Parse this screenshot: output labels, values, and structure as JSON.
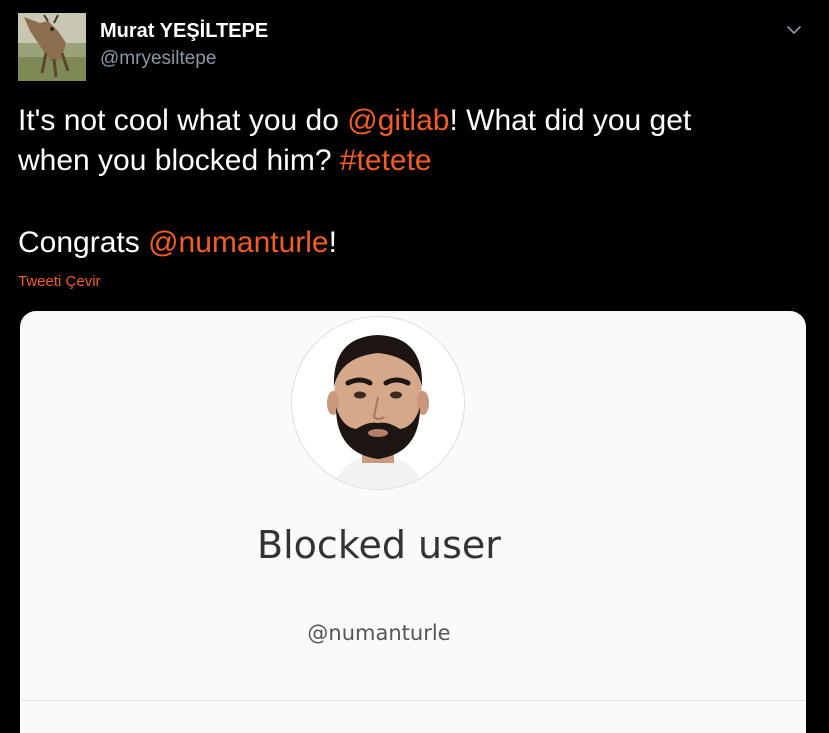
{
  "colors": {
    "background": "#000000",
    "accent": "#f45d22",
    "secondary_text": "#8899a6",
    "card_background": "#fafafa"
  },
  "author": {
    "name": "Murat YEŞİLTEPE",
    "handle": "@mryesiltepe",
    "avatar_icon": "goat-avatar"
  },
  "tweet": {
    "line1_prefix": "It's not cool what you do ",
    "line1_mention": "@gitlab",
    "line1_suffix": "! What did you get",
    "line2_prefix": "when you blocked him? ",
    "line2_hashtag": "#tetete",
    "line3_prefix": "Congrats ",
    "line3_mention": "@numanturle",
    "line3_suffix": "!",
    "translate_link": "Tweeti Çevir"
  },
  "card": {
    "title": "Blocked user",
    "handle": "@numanturle",
    "photo_icon": "bearded-man-profile-photo"
  },
  "menu_icon": "chevron-down-icon"
}
